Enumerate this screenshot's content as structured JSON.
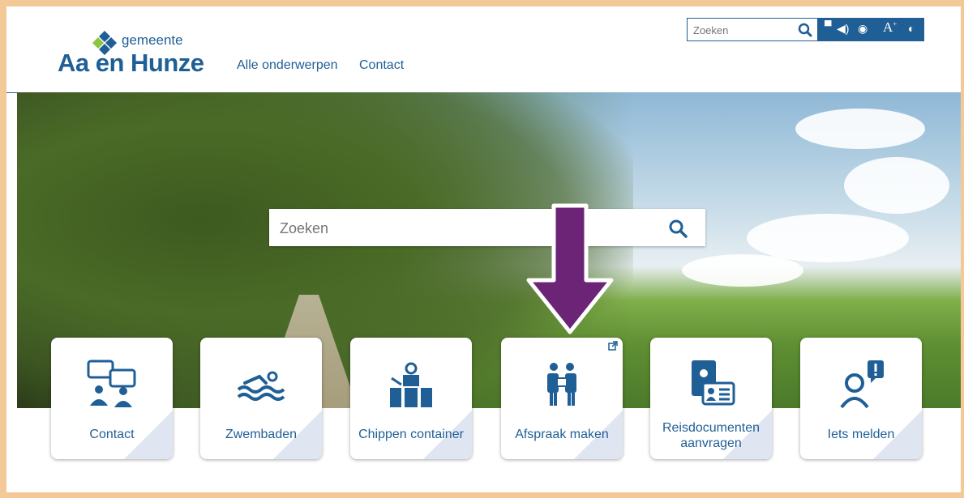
{
  "header": {
    "logo_small": "gemeente",
    "logo_big": "Aa en Hunze",
    "nav": [
      "Alle onderwerpen",
      "Contact"
    ],
    "top_search_placeholder": "Zoeken",
    "a11y_icons": [
      "menu-icon",
      "speaker-icon",
      "eye-icon",
      "font-size-icon",
      "contrast-icon"
    ]
  },
  "hero": {
    "search_placeholder": "Zoeken"
  },
  "tiles": [
    {
      "label": "Contact",
      "icon": "chat-people-icon"
    },
    {
      "label": "Zwembaden",
      "icon": "swimmer-icon"
    },
    {
      "label": "Chippen container",
      "icon": "container-icon"
    },
    {
      "label": "Afspraak maken",
      "icon": "people-appointment-icon"
    },
    {
      "label": "Reisdocumenten aanvragen",
      "icon": "id-document-icon"
    },
    {
      "label": "Iets melden",
      "icon": "report-icon"
    }
  ],
  "colors": {
    "brand_blue": "#1f5f96",
    "accent_green": "#8cc63f",
    "arrow_purple": "#6b2476",
    "frame": "#f3c998"
  }
}
